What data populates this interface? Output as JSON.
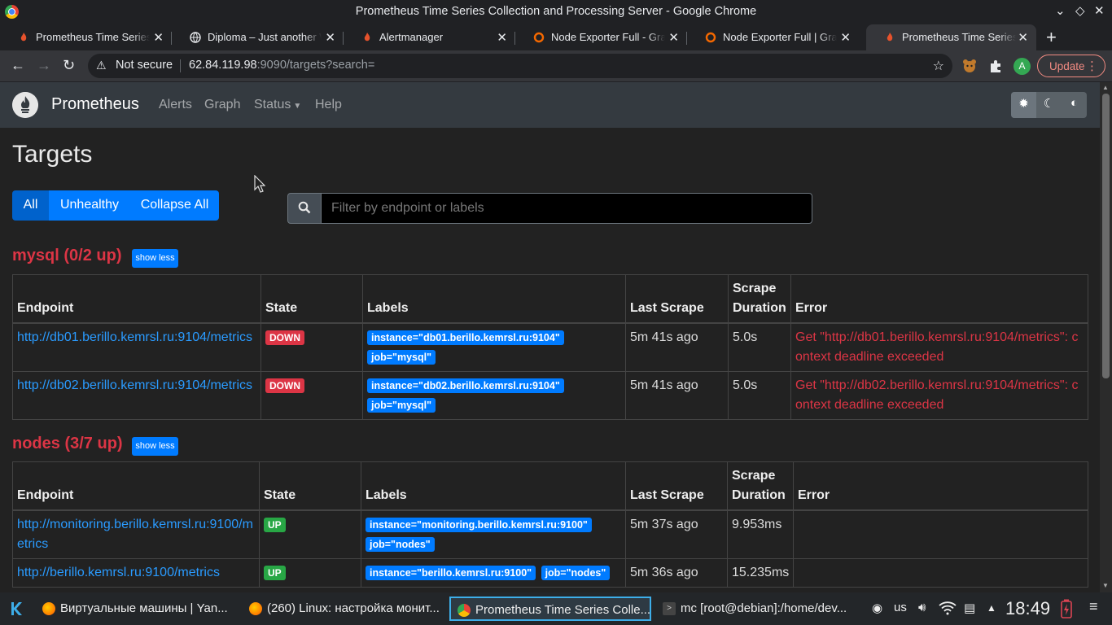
{
  "window": {
    "title": "Prometheus Time Series Collection and Processing Server - Google Chrome"
  },
  "tabs": [
    {
      "label": "Prometheus Time Series"
    },
    {
      "label": "Diploma – Just another W"
    },
    {
      "label": "Alertmanager"
    },
    {
      "label": "Node Exporter Full - Graf"
    },
    {
      "label": "Node Exporter Full | Gra"
    },
    {
      "label": "Prometheus Time Series"
    }
  ],
  "omnibox": {
    "security": "Not secure",
    "host": "62.84.119.98",
    "rest": ":9090/targets?search="
  },
  "profile_initial": "A",
  "update_label": "Update",
  "navbar": {
    "brand": "Prometheus",
    "links": {
      "alerts": "Alerts",
      "graph": "Graph",
      "status": "Status",
      "help": "Help"
    }
  },
  "page": {
    "title": "Targets",
    "filters": {
      "all": "All",
      "unhealthy": "Unhealthy",
      "collapse": "Collapse All"
    },
    "search_placeholder": "Filter by endpoint or labels"
  },
  "columns": {
    "endpoint": "Endpoint",
    "state": "State",
    "labels": "Labels",
    "last_scrape": "Last Scrape",
    "scrape_duration": "Scrape Duration",
    "error": "Error"
  },
  "pools": [
    {
      "title": "mysql (0/2 up)",
      "toggle": "show less",
      "rows": [
        {
          "endpoint": "http://db01.berillo.kemrsl.ru:9104/metrics",
          "state": "DOWN",
          "labels": [
            "instance=\"db01.berillo.kemrsl.ru:9104\"",
            "job=\"mysql\""
          ],
          "last_scrape": "5m 41s ago",
          "duration": "5.0s",
          "error": "Get \"http://db01.berillo.kemrsl.ru:9104/metrics\": context deadline exceeded"
        },
        {
          "endpoint": "http://db02.berillo.kemrsl.ru:9104/metrics",
          "state": "DOWN",
          "labels": [
            "instance=\"db02.berillo.kemrsl.ru:9104\"",
            "job=\"mysql\""
          ],
          "last_scrape": "5m 41s ago",
          "duration": "5.0s",
          "error": "Get \"http://db02.berillo.kemrsl.ru:9104/metrics\": context deadline exceeded"
        }
      ]
    },
    {
      "title": "nodes (3/7 up)",
      "toggle": "show less",
      "rows": [
        {
          "endpoint": "http://monitoring.berillo.kemrsl.ru:9100/metrics",
          "state": "UP",
          "labels": [
            "instance=\"monitoring.berillo.kemrsl.ru:9100\"",
            "job=\"nodes\""
          ],
          "last_scrape": "5m 37s ago",
          "duration": "9.953ms",
          "error": ""
        },
        {
          "endpoint": "http://berillo.kemrsl.ru:9100/metrics",
          "state": "UP",
          "labels": [
            "instance=\"berillo.kemrsl.ru:9100\"",
            "job=\"nodes\""
          ],
          "last_scrape": "5m 36s ago",
          "duration": "15.235ms",
          "error": ""
        }
      ]
    }
  ],
  "taskbar": {
    "tasks": [
      {
        "label": "Виртуальные машины | Yan..."
      },
      {
        "label": "(260) Linux: настройка монит..."
      },
      {
        "label": "Prometheus Time Series Colle..."
      },
      {
        "label": "mc [root@debian]:/home/dev..."
      }
    ],
    "keyboard": "us",
    "clock": "18:49"
  },
  "colors": {
    "accent": "#007bff",
    "danger": "#dc3545",
    "success": "#28a745",
    "navbar": "#343a40",
    "background": "#222222"
  }
}
